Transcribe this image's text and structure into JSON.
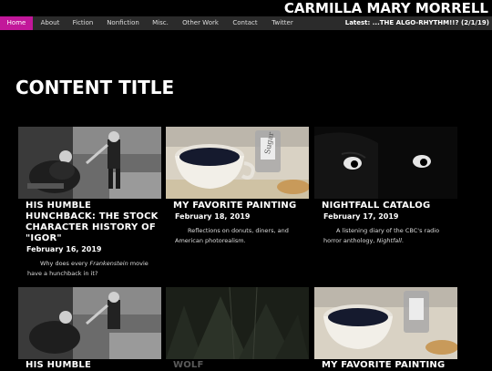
{
  "site": {
    "title": "CARMILLA MARY MORRELL"
  },
  "nav": {
    "items": [
      "Home",
      "About",
      "Fiction",
      "Nonfiction",
      "Misc.",
      "Other Work",
      "Contact",
      "Twitter"
    ],
    "latest": "Latest: ...THE ALGO-RHYTHM!!? (2/1/19)"
  },
  "main": {
    "content_title": "CONTENT TITLE"
  },
  "cards": [
    {
      "title": "HIS HUMBLE HUNCHBACK: THE STOCK CHARACTER HISTORY OF \"IGOR\"",
      "date": "February 16, 2019",
      "desc_pre": "Why does every ",
      "desc_em": "Frankenstein",
      "desc_post": " movie have a hunchback in it?"
    },
    {
      "title": "MY FAVORITE PAINTING",
      "date": "February 18, 2019",
      "desc_pre": "Reflections on donuts, diners, and American photorealism.",
      "desc_em": "",
      "desc_post": ""
    },
    {
      "title": "NIGHTFALL CATALOG",
      "date": "February 17, 2019",
      "desc_pre": "A listening diary of the CBC's radio horror anthology, ",
      "desc_em": "Nightfall",
      "desc_post": "."
    },
    {
      "title": "HIS HUMBLE"
    },
    {
      "title": "WOLF"
    },
    {
      "title": "MY FAVORITE PAINTING"
    }
  ],
  "colors": {
    "nav_active": "#c2179a",
    "nav_bg": "#2b2b2b",
    "background": "#000000"
  }
}
